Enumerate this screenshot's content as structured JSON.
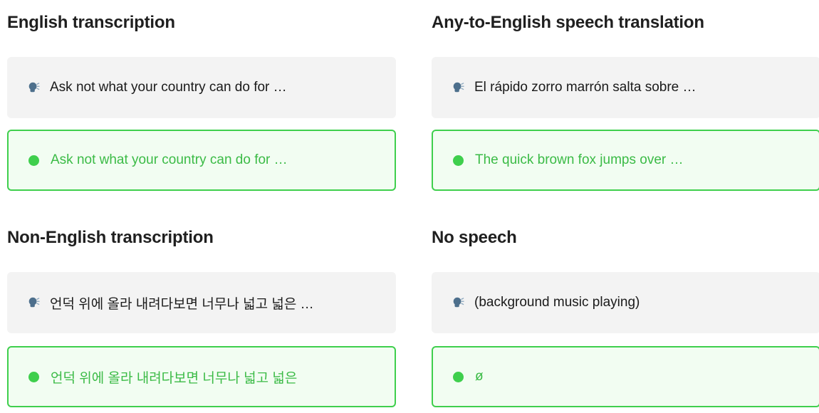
{
  "panels": [
    {
      "title": "English transcription",
      "input": "Ask not what your country can do for …",
      "output": "Ask not what your country can do for …"
    },
    {
      "title": "Any-to-English speech translation",
      "input": "El rápido zorro marrón salta sobre …",
      "output": "The quick brown fox jumps over …"
    },
    {
      "title": "Non-English transcription",
      "input": "언덕 위에 올라 내려다보면 너무나 넓고 넓은 …",
      "output": "언덕 위에 올라 내려다보면 너무나 넓고 넓은"
    },
    {
      "title": "No speech",
      "input": "(background music playing)",
      "output": "ø"
    }
  ],
  "icons": {
    "input": "speaking-head-icon",
    "output": "status-dot-icon"
  },
  "colors": {
    "input_bg": "#f3f3f3",
    "output_bg": "#f2fdf2",
    "output_border": "#3fcf4d",
    "output_text": "#3bbb46"
  }
}
